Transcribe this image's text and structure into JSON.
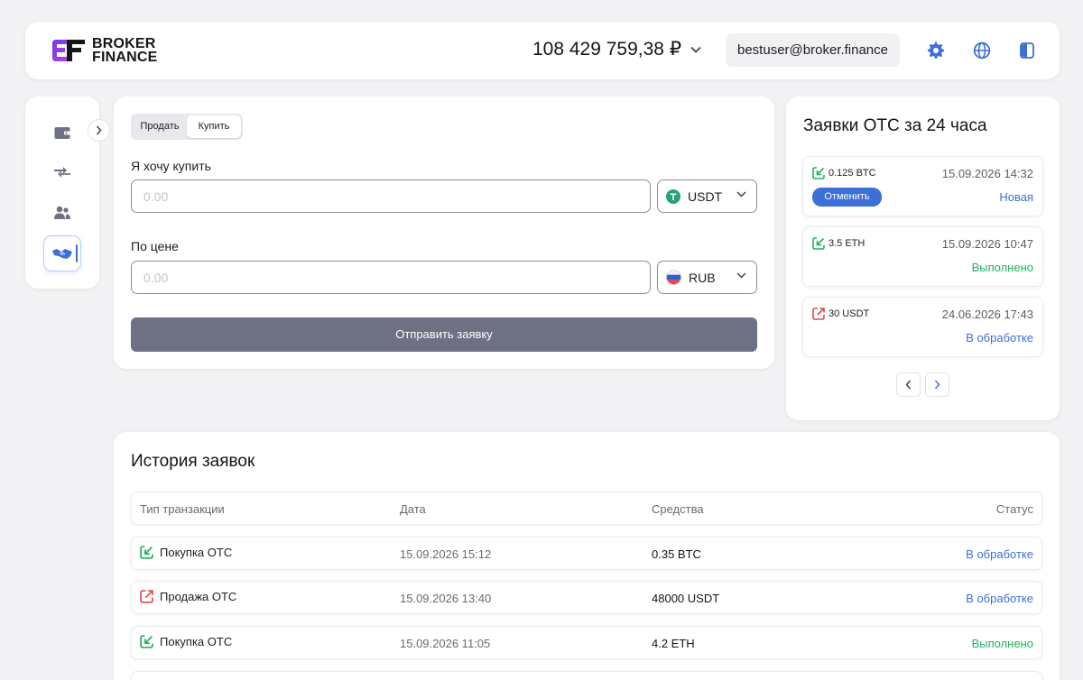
{
  "header": {
    "logo_line1": "BROKER",
    "logo_line2": "FINANCE",
    "balance": "108 429 759,38 ₽",
    "email": "bestuser@broker.finance",
    "icons": [
      "settings-icon",
      "globe-icon",
      "logout-icon"
    ]
  },
  "sidenav": {
    "items": [
      "wallet-icon",
      "transfer-icon",
      "users-icon",
      "handshake-icon"
    ],
    "active": "handshake-icon"
  },
  "form": {
    "tabs": [
      "Продать",
      "Купить"
    ],
    "active_tab": "Купить",
    "want_label": "Я хочу купить",
    "amount_placeholder": "0.00",
    "amount_currency": "USDT",
    "price_label": "По цене",
    "price_placeholder": "0.00",
    "price_currency": "RUB",
    "submit_label": "Отправить заявку"
  },
  "otc": {
    "title": "Заявки OTC за 24 часа",
    "items": [
      {
        "direction": "buy",
        "amount": "0.125 BTC",
        "date": "15.09.2026 14:32",
        "status": "Новая",
        "action": "Отменить"
      },
      {
        "direction": "buy",
        "amount": "3.5 ETH",
        "date": "15.09.2026 10:47",
        "status": "Выполнено"
      },
      {
        "direction": "sell",
        "amount": "30 USDT",
        "date": "24.06.2026 17:43",
        "status": "В обработке"
      }
    ]
  },
  "history": {
    "title": "История заявок",
    "columns": [
      "Тип транзакции",
      "Дата",
      "Средства",
      "Статус"
    ],
    "rows": [
      {
        "direction": "buy",
        "type": "Покупка OTC",
        "date": "15.09.2026 15:12",
        "amount": "0.35 BTC",
        "status": "В обработке"
      },
      {
        "direction": "sell",
        "type": "Продажа OTC",
        "date": "15.09.2026 13:40",
        "amount": "48000 USDT",
        "status": "В обработке"
      },
      {
        "direction": "buy",
        "type": "Покупка OTC",
        "date": "15.09.2026 11:05",
        "amount": "4.2 ETH",
        "status": "Выполнено"
      }
    ]
  },
  "colors": {
    "accent": "#3d6fd8",
    "success": "#22b25e",
    "danger": "#e5484d",
    "submit_bg": "#6d7183"
  }
}
